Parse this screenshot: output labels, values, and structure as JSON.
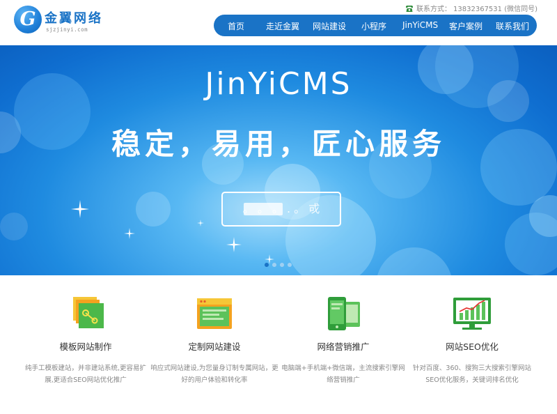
{
  "brand": {
    "logo_letter": "G",
    "name": "金翼网络",
    "domain": "sjzjinyi.com",
    "color": "#1a73c6"
  },
  "contact": {
    "icon": "phone-icon",
    "label": "联系方式：",
    "number": "13832367531 (微信同号)"
  },
  "nav": {
    "items": [
      {
        "label": "首页"
      },
      {
        "label": "走近金翼"
      },
      {
        "label": "网站建设"
      },
      {
        "label": "小程序"
      },
      {
        "label": "JinYiCMS"
      },
      {
        "label": "客户案例"
      },
      {
        "label": "联系我们"
      }
    ]
  },
  "banner": {
    "title": "JinYiCMS",
    "slogan": "稳定，易用，匠心服务",
    "button_label": "。 。 。 . 。 戓",
    "carousel": {
      "total": 4,
      "active": 1
    }
  },
  "services": [
    {
      "icon": "template-website-icon",
      "title": "模板网站制作",
      "description": "纯手工模板建站，并非建站系统,更容易扩展,更适合SEO网站优化推广"
    },
    {
      "icon": "custom-website-icon",
      "title": "定制网站建设",
      "description": "响应式网站建设,为您量身订制专属网站，更好的用户体验和转化率"
    },
    {
      "icon": "marketing-icon",
      "title": "网络营销推广",
      "description": "电脑端+手机端+微信端，主流搜索引擎网络营销推广"
    },
    {
      "icon": "seo-chart-icon",
      "title": "网站SEO优化",
      "description": "针对百度、360、搜狗三大搜索引擎网站SEO优化服务，关键词排名优化"
    }
  ]
}
